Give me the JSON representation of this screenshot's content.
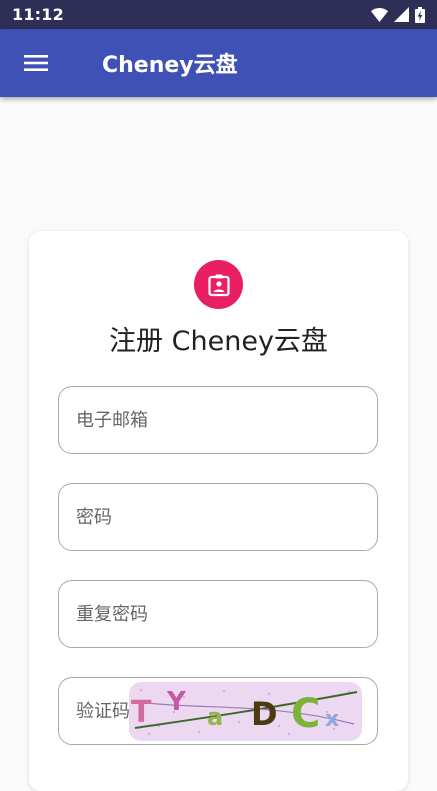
{
  "status_bar": {
    "time": "11:12"
  },
  "app_bar": {
    "title": "Cheney云盘",
    "menu_icon": "menu-icon"
  },
  "card": {
    "badge_icon": "contact-clipboard-icon",
    "title": "注册 Cheney云盘",
    "fields": {
      "email": {
        "placeholder": "电子邮箱"
      },
      "password": {
        "placeholder": "密码"
      },
      "repeat_password": {
        "placeholder": "重复密码"
      },
      "captcha": {
        "placeholder": "验证码"
      }
    },
    "captcha_image": {
      "text": "TYaDCx"
    }
  },
  "colors": {
    "status_bar": "#2d2f57",
    "app_bar": "#3f51b5",
    "badge": "#e91e63",
    "background": "#fafafa"
  }
}
